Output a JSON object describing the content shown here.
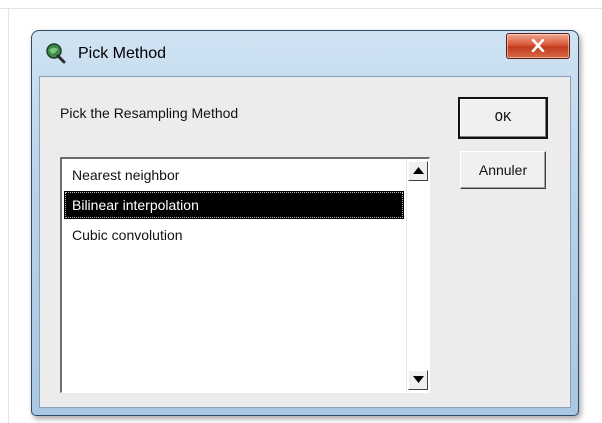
{
  "window": {
    "title": "Pick Method",
    "app_icon": "magnifier-globe-icon",
    "close_icon": "close-icon",
    "close_color": "#d1482a"
  },
  "dialog": {
    "prompt": "Pick the Resampling Method",
    "ok_label": "OK",
    "cancel_label": "Annuler"
  },
  "methods": {
    "items": [
      "Nearest neighbor",
      "Bilinear interpolation",
      "Cubic convolution"
    ],
    "selected": "Bilinear interpolation"
  },
  "scrollbar": {
    "up_icon": "arrow-up-icon",
    "down_icon": "arrow-down-icon"
  }
}
